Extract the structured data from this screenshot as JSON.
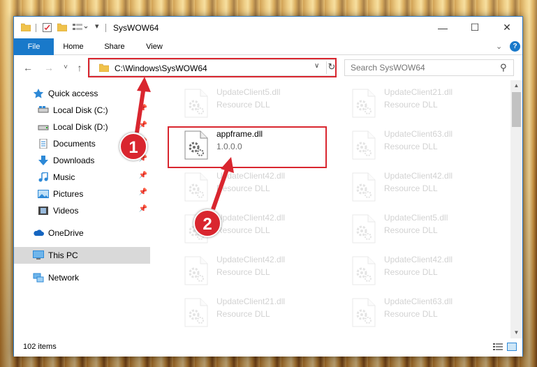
{
  "window": {
    "title": "SysWOW64",
    "controls": {
      "minimize": "—",
      "maximize": "☐",
      "close": "✕"
    }
  },
  "ribbon": {
    "tabs": [
      {
        "label": "File",
        "active": true
      },
      {
        "label": "Home"
      },
      {
        "label": "Share"
      },
      {
        "label": "View"
      }
    ],
    "collapse_icon": "chevron-down-icon",
    "help_label": "?"
  },
  "nav": {
    "back": "←",
    "forward": "→",
    "recent": "˅",
    "up": "↑",
    "address": "C:\\Windows\\SysWOW64",
    "refresh": "↻",
    "dropdown": "∨",
    "search_placeholder": "Search SysWOW64",
    "search_icon": "⚲"
  },
  "sidebar": {
    "items": [
      {
        "label": "Quick access",
        "icon": "star-icon"
      },
      {
        "label": "Local Disk (C:)",
        "icon": "drive-icon",
        "pinned": true
      },
      {
        "label": "Local Disk (D:)",
        "icon": "drive-icon",
        "pinned": true
      },
      {
        "label": "Documents",
        "icon": "document-icon",
        "pinned": true
      },
      {
        "label": "Downloads",
        "icon": "download-icon",
        "pinned": true
      },
      {
        "label": "Music",
        "icon": "music-icon",
        "pinned": true
      },
      {
        "label": "Pictures",
        "icon": "pictures-icon",
        "pinned": true
      },
      {
        "label": "Videos",
        "icon": "video-icon",
        "pinned": true
      },
      {
        "label": "OneDrive",
        "icon": "cloud-icon"
      },
      {
        "label": "This PC",
        "icon": "computer-icon",
        "selected": true
      },
      {
        "label": "Network",
        "icon": "network-icon"
      }
    ]
  },
  "files": {
    "col1": [
      {
        "name": "UpdateClient5.dll",
        "sub": "Resource DLL",
        "faded": true
      },
      {
        "name": "appframe.dll",
        "sub": "1.0.0.0",
        "faded": false
      },
      {
        "name": "UpdateClient42.dll",
        "sub": "Resource DLL",
        "faded": true
      },
      {
        "name": "UpdateClient42.dll",
        "sub": "Resource DLL",
        "faded": true
      },
      {
        "name": "UpdateClient42.dll",
        "sub": "Resource DLL",
        "faded": true
      },
      {
        "name": "UpdateClient21.dll",
        "sub": "Resource DLL",
        "faded": true
      }
    ],
    "col2": [
      {
        "name": "UpdateClient21.dll",
        "sub": "Resource DLL",
        "faded": true
      },
      {
        "name": "UpdateClient63.dll",
        "sub": "Resource DLL",
        "faded": true
      },
      {
        "name": "UpdateClient42.dll",
        "sub": "Resource DLL",
        "faded": true
      },
      {
        "name": "UpdateClient5.dll",
        "sub": "Resource DLL",
        "faded": true
      },
      {
        "name": "UpdateClient42.dll",
        "sub": "Resource DLL",
        "faded": true
      },
      {
        "name": "UpdateClient63.dll",
        "sub": "Resource DLL",
        "faded": true
      }
    ]
  },
  "status": {
    "item_count": "102 items"
  },
  "annotations": {
    "badge1": "1",
    "badge2": "2"
  },
  "colors": {
    "accent": "#1979ca",
    "highlight": "#d9262f",
    "selected_bg": "#d9d9d9"
  }
}
